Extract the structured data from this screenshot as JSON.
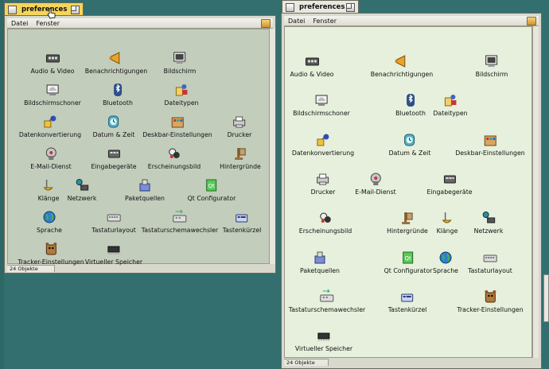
{
  "left_window": {
    "title": "preferences",
    "menu": [
      "Datei",
      "Fenster"
    ],
    "status": "24 Objekte",
    "items": [
      {
        "label": "Audio & Video",
        "icon": "audio-video-icon"
      },
      {
        "label": "Benachrichtigungen",
        "icon": "notifications-icon"
      },
      {
        "label": "Bildschirm",
        "icon": "screen-icon"
      },
      {
        "label": "Bildschirmschoner",
        "icon": "screensaver-icon"
      },
      {
        "label": "Bluetooth",
        "icon": "bluetooth-icon"
      },
      {
        "label": "Dateitypen",
        "icon": "filetypes-icon"
      },
      {
        "label": "Datenkonvertierung",
        "icon": "data-translation-icon"
      },
      {
        "label": "Datum & Zeit",
        "icon": "clock-icon"
      },
      {
        "label": "Deskbar-Einstellungen",
        "icon": "deskbar-icon"
      },
      {
        "label": "Drucker",
        "icon": "printer-icon"
      },
      {
        "label": "E-Mail-Dienst",
        "icon": "email-icon"
      },
      {
        "label": "Eingabegeräte",
        "icon": "input-icon"
      },
      {
        "label": "Erscheinungsbild",
        "icon": "appearance-icon"
      },
      {
        "label": "Hintergründe",
        "icon": "backgrounds-icon"
      },
      {
        "label": "Klänge",
        "icon": "sounds-icon"
      },
      {
        "label": "Netzwerk",
        "icon": "network-icon"
      },
      {
        "label": "Paketquellen",
        "icon": "repositories-icon"
      },
      {
        "label": "Qt Configurator",
        "icon": "qt-icon"
      },
      {
        "label": "Sprache",
        "icon": "globe-icon"
      },
      {
        "label": "Tastaturlayout",
        "icon": "keyboard-icon"
      },
      {
        "label": "Tastaturschemawechsler",
        "icon": "keymap-switcher-icon"
      },
      {
        "label": "Tastenkürzel",
        "icon": "shortcuts-icon"
      },
      {
        "label": "Tracker-Einstellungen",
        "icon": "tracker-icon"
      },
      {
        "label": "Virtueller Speicher",
        "icon": "memory-chip-icon"
      }
    ]
  },
  "right_window": {
    "title": "preferences",
    "menu": [
      "Datei",
      "Fenster"
    ],
    "status": "24 Objekte",
    "items": [
      {
        "label": "Audio & Video",
        "icon": "audio-video-icon"
      },
      {
        "label": "Benachrichtigungen",
        "icon": "notifications-icon"
      },
      {
        "label": "Bildschirm",
        "icon": "screen-icon"
      },
      {
        "label": "Bildschirmschoner",
        "icon": "screensaver-icon"
      },
      {
        "label": "Bluetooth",
        "icon": "bluetooth-icon"
      },
      {
        "label": "Dateitypen",
        "icon": "filetypes-icon"
      },
      {
        "label": "Datenkonvertierung",
        "icon": "data-translation-icon"
      },
      {
        "label": "Datum & Zeit",
        "icon": "clock-icon"
      },
      {
        "label": "Deskbar-Einstellungen",
        "icon": "deskbar-icon"
      },
      {
        "label": "Drucker",
        "icon": "printer-icon"
      },
      {
        "label": "E-Mail-Dienst",
        "icon": "email-icon"
      },
      {
        "label": "Eingabegeräte",
        "icon": "input-icon"
      },
      {
        "label": "Erscheinungsbild",
        "icon": "appearance-icon"
      },
      {
        "label": "Hintergründe",
        "icon": "backgrounds-icon"
      },
      {
        "label": "Klänge",
        "icon": "sounds-icon"
      },
      {
        "label": "Netzwerk",
        "icon": "network-icon"
      },
      {
        "label": "Paketquellen",
        "icon": "repositories-icon"
      },
      {
        "label": "Qt Configurator",
        "icon": "qt-icon"
      },
      {
        "label": "Sprache",
        "icon": "globe-icon"
      },
      {
        "label": "Tastaturlayout",
        "icon": "keyboard-icon"
      },
      {
        "label": "Tastaturschemawechsler",
        "icon": "keymap-switcher-icon"
      },
      {
        "label": "Tastenkürzel",
        "icon": "shortcuts-icon"
      },
      {
        "label": "Tracker-Einstellungen",
        "icon": "tracker-icon"
      },
      {
        "label": "Virtueller Speicher",
        "icon": "memory-chip-icon"
      }
    ]
  },
  "colors": {
    "desktop": "#336f6e",
    "active_tab": "#f5d55a",
    "inactive_tab": "#e8e8e0",
    "left_content": "#c3cdbb",
    "right_content": "#e6f0dc"
  }
}
